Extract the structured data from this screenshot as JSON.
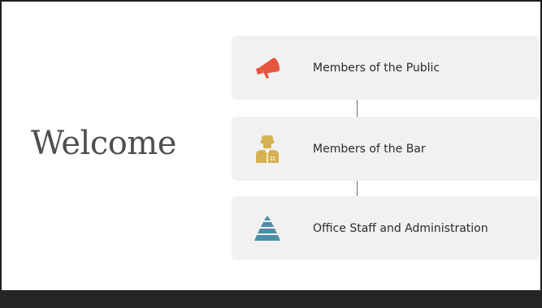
{
  "slide": {
    "title": "Welcome"
  },
  "menu": {
    "items": [
      {
        "label": "Members of the Public",
        "icon": "megaphone-icon",
        "icon_color": "#e8553f"
      },
      {
        "label": "Members of the Bar",
        "icon": "lawyer-icon",
        "icon_color": "#d6b253"
      },
      {
        "label": "Office Staff and Administration",
        "icon": "pyramid-icon",
        "icon_color": "#4a8ea8"
      }
    ]
  },
  "colors": {
    "card_background": "#f1f1f1",
    "footer_bar": "#262626",
    "title_text": "#4f4f4f"
  }
}
